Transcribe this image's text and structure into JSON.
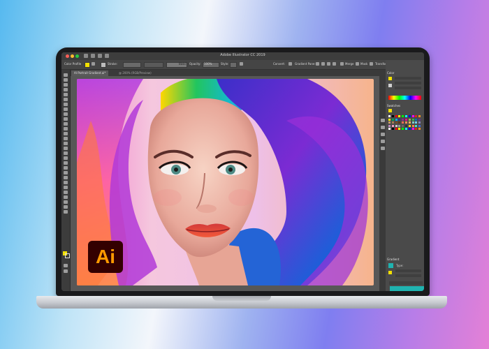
{
  "window": {
    "app_title": "Adobe Illustrator CC 2019"
  },
  "control_bar": {
    "selection_label": "Color Profile",
    "stroke_label": "Stroke:",
    "brush_label": "Basic",
    "opacity_label": "Opacity:",
    "opacity_value": "100%",
    "style_label": "Style:",
    "convert_label": "Convert:",
    "gradient_label": "Gradient Pane:",
    "mesh_label": "Merge",
    "mask_label": "Mask",
    "transform_label": "Transform"
  },
  "tabs": [
    {
      "label": "AI Portrait Gradient.ai*",
      "active": true
    },
    {
      "label": "@ 200% (RGB/Preview)",
      "active": false
    }
  ],
  "panels": {
    "color_title": "Color",
    "swatches_title": "Swatches",
    "gradient_title": "Gradient",
    "gradient_type_label": "Type:"
  },
  "logo": {
    "text": "Ai"
  },
  "colors": {
    "fill": "#f2e000",
    "gradient_preview": "#1fb3b0",
    "logo_bg": "#330000",
    "logo_fg": "#ff9a00"
  }
}
